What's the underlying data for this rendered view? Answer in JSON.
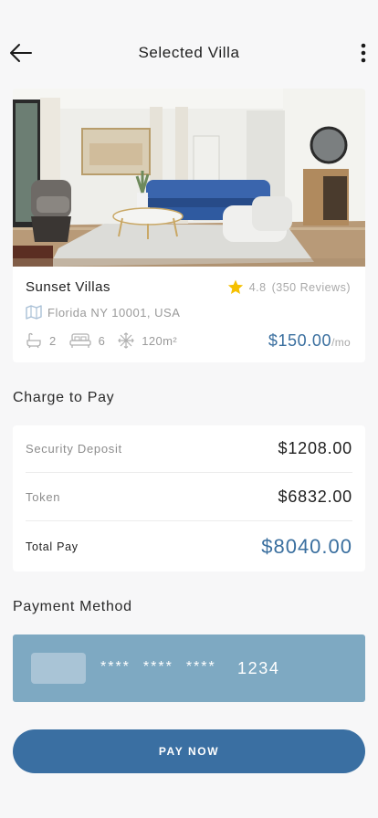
{
  "header": {
    "title": "Selected Villa"
  },
  "villa": {
    "name": "Sunset Villas",
    "rating": "4.8",
    "reviews": "(350 Reviews)",
    "address": "Florida NY 10001, USA",
    "baths": "2",
    "beds": "6",
    "area": "120m²",
    "price": "$150.00",
    "price_unit": "/mo"
  },
  "charges": {
    "title": "Charge to Pay",
    "rows": [
      {
        "label": "Security Deposit",
        "value": "$1208.00"
      },
      {
        "label": "Token",
        "value": "$6832.00"
      }
    ],
    "total_label": "Total Pay",
    "total_value": "$8040.00"
  },
  "payment": {
    "title": "Payment Method",
    "masked": [
      "****",
      "****",
      "****"
    ],
    "last4": "1234"
  },
  "actions": {
    "pay_label": "PAY NOW"
  },
  "colors": {
    "accent": "#3a6fa2",
    "card_bg": "#7ea9c2",
    "star": "#f5c000"
  },
  "icons": [
    "back-arrow-icon",
    "more-vertical-icon",
    "star-icon",
    "map-icon",
    "bathtub-icon",
    "bed-icon",
    "area-icon"
  ]
}
